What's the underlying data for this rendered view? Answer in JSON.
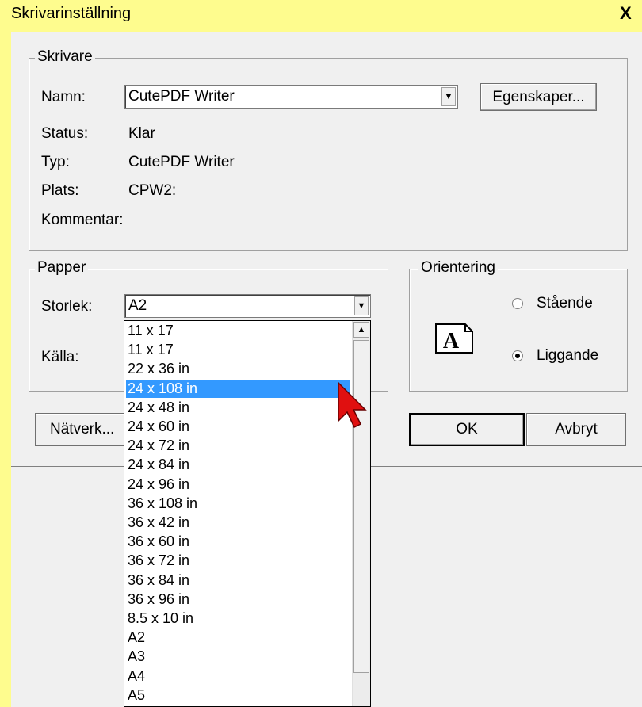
{
  "window": {
    "title": "Skrivarinställning",
    "close_glyph": "X"
  },
  "printer_group": {
    "legend": "Skrivare",
    "name_label": "Namn:",
    "name_value": "CutePDF Writer",
    "properties_button": "Egenskaper...",
    "status_label": "Status:",
    "status_value": "Klar",
    "type_label": "Typ:",
    "type_value": "CutePDF Writer",
    "location_label": "Plats:",
    "location_value": "CPW2:",
    "comment_label": "Kommentar:"
  },
  "paper_group": {
    "legend": "Papper",
    "size_label": "Storlek:",
    "size_value": "A2",
    "source_label": "Källa:",
    "size_options": [
      "11 x 17",
      "11 x 17",
      "22 x 36 in",
      "24 x 108 in",
      "24 x 48 in",
      "24 x 60 in",
      "24 x 72 in",
      "24 x 84 in",
      "24 x 96 in",
      "36 x 108 in",
      "36 x 42 in",
      "36 x 60 in",
      "36 x 72 in",
      "36 x 84 in",
      "36 x 96 in",
      "8.5 x 10 in",
      "A2",
      "A3",
      "A4",
      "A5"
    ],
    "highlighted_option": "24 x 108 in"
  },
  "orientation_group": {
    "legend": "Orientering",
    "portrait_label": "Stående",
    "landscape_label": "Liggande",
    "selected": "Liggande",
    "icon": "page-letter-a-icon",
    "icon_letter": "A"
  },
  "buttons": {
    "network": "Nätverk...",
    "ok": "OK",
    "cancel": "Avbryt"
  },
  "colors": {
    "selection": "#3399ff",
    "cursor": "#e01010",
    "background": "#fefc8e",
    "dialog": "#f0f0f0"
  }
}
